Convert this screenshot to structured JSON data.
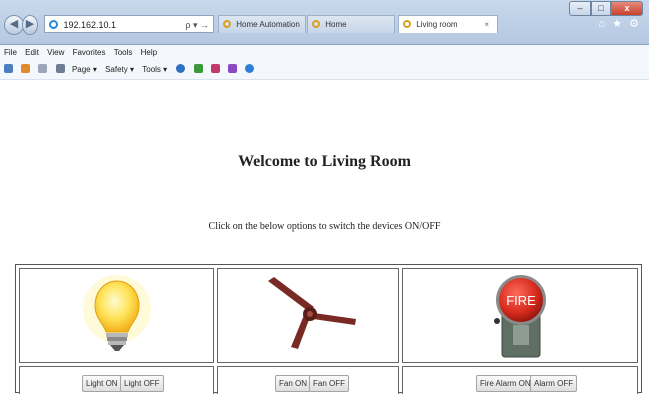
{
  "browser": {
    "url": "192.162.10.1",
    "address_tools": "ρ ▾ →",
    "tabs": [
      {
        "label": "Home Automation"
      },
      {
        "label": "Home"
      },
      {
        "label": "Living room"
      }
    ],
    "tab_close": "×",
    "right_tools": "⌂ ★ ⚙",
    "window_controls": {
      "minimize": "–",
      "maximize": "□",
      "close": "x"
    },
    "menu": [
      "File",
      "Edit",
      "View",
      "Favorites",
      "Tools",
      "Help"
    ],
    "command_bar": [
      "Page ▾",
      "Safety ▾",
      "Tools ▾"
    ]
  },
  "page": {
    "heading": "Welcome to Living Room",
    "instructions": "Click on the below options to switch the devices ON/OFF",
    "devices": [
      {
        "name": "light",
        "icon": "light-bulb-icon",
        "on_label": "Light ON",
        "off_label": "Light OFF"
      },
      {
        "name": "fan",
        "icon": "ceiling-fan-icon",
        "on_label": "Fan ON",
        "off_label": "Fan OFF"
      },
      {
        "name": "fire-alarm",
        "icon": "fire-alarm-icon",
        "icon_text": "FIRE",
        "on_label": "Fire Alarm ON",
        "off_label": "Alarm OFF"
      }
    ]
  },
  "colors": {
    "chrome": "#c9d9ec",
    "alarm_red": "#d42a1c",
    "bulb_yellow": "#ffd84a",
    "fan_brown": "#7a2a24"
  }
}
